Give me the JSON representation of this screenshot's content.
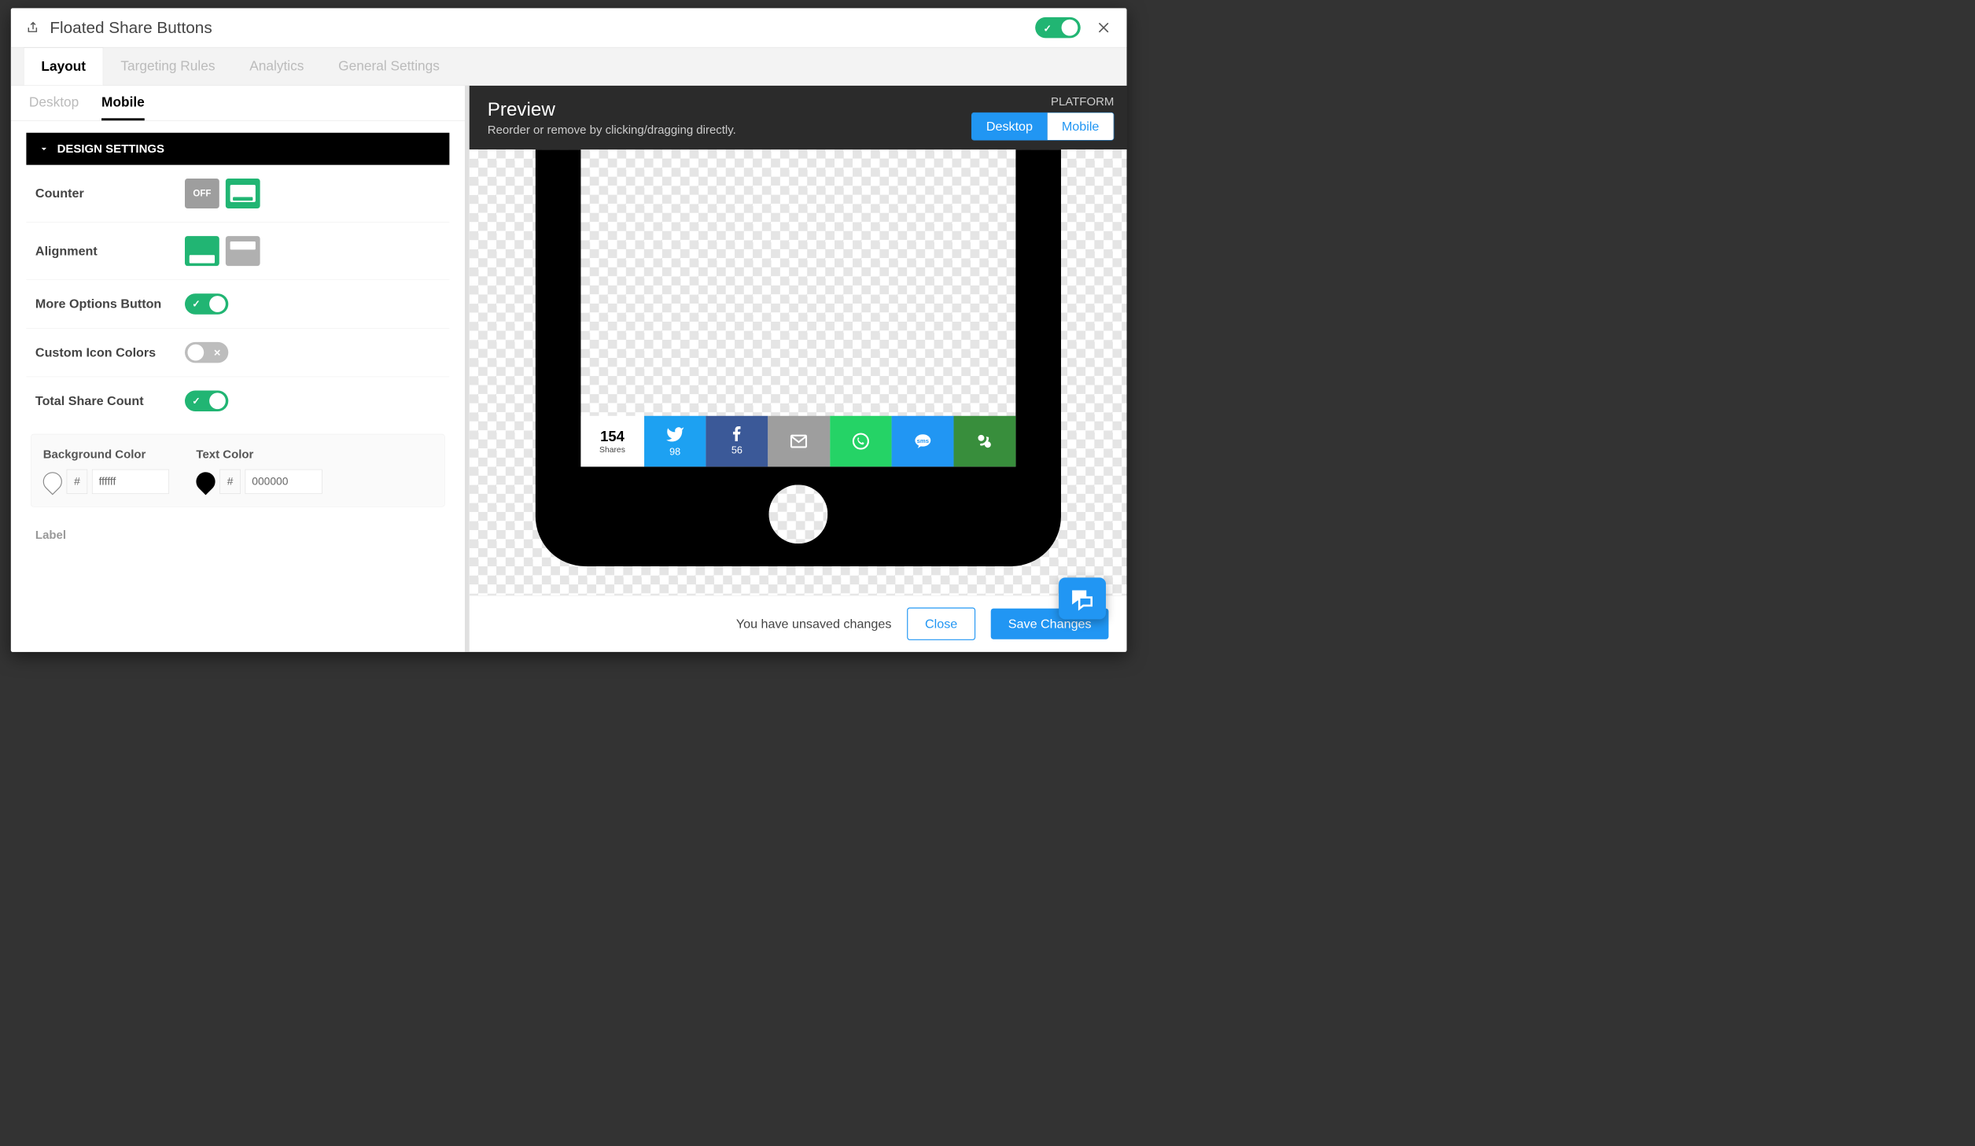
{
  "header": {
    "title": "Floated Share Buttons"
  },
  "tabs": [
    "Layout",
    "Targeting Rules",
    "Analytics",
    "General Settings"
  ],
  "subtabs": [
    "Desktop",
    "Mobile"
  ],
  "section_title": "DESIGN SETTINGS",
  "rows": {
    "counter": "Counter",
    "counter_off": "OFF",
    "alignment": "Alignment",
    "more_options": "More Options Button",
    "custom_colors": "Custom Icon Colors",
    "total_share": "Total Share Count",
    "bg_color": "Background Color",
    "text_color": "Text Color",
    "bg_hex": "ffffff",
    "text_hex": "000000",
    "hash": "#",
    "label": "Label"
  },
  "preview": {
    "title": "Preview",
    "subtitle": "Reorder or remove by clicking/dragging directly.",
    "platform_label": "PLATFORM",
    "desktop": "Desktop",
    "mobile": "Mobile",
    "total": "154",
    "shares": "Shares",
    "tw_count": "98",
    "fb_count": "56"
  },
  "footer": {
    "unsaved": "You have unsaved changes",
    "close": "Close",
    "save": "Save Changes"
  }
}
